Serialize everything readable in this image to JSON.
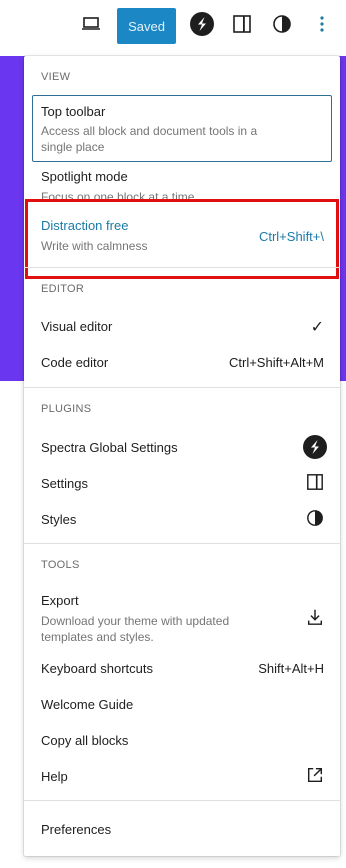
{
  "topbar": {
    "saved_label": "Saved"
  },
  "menu": {
    "view": {
      "title": "VIEW",
      "top_toolbar": {
        "label": "Top toolbar",
        "desc": "Access all block and document tools in a single place"
      },
      "spotlight": {
        "label": "Spotlight mode",
        "desc": "Focus on one block at a time"
      },
      "distraction": {
        "label": "Distraction free",
        "desc": "Write with calmness",
        "shortcut": "Ctrl+Shift+\\"
      }
    },
    "editor": {
      "title": "EDITOR",
      "visual": {
        "label": "Visual editor",
        "check": "✓"
      },
      "code": {
        "label": "Code editor",
        "shortcut": "Ctrl+Shift+Alt+M"
      }
    },
    "plugins": {
      "title": "PLUGINS",
      "spectra": {
        "label": "Spectra Global Settings"
      },
      "settings": {
        "label": "Settings"
      },
      "styles": {
        "label": "Styles"
      }
    },
    "tools": {
      "title": "TOOLS",
      "export": {
        "label": "Export",
        "desc": "Download your theme with updated templates and styles."
      },
      "keyboard": {
        "label": "Keyboard shortcuts",
        "shortcut": "Shift+Alt+H"
      },
      "welcome": {
        "label": "Welcome Guide"
      },
      "copy": {
        "label": "Copy all blocks"
      },
      "help": {
        "label": "Help"
      }
    },
    "preferences": {
      "label": "Preferences"
    }
  }
}
